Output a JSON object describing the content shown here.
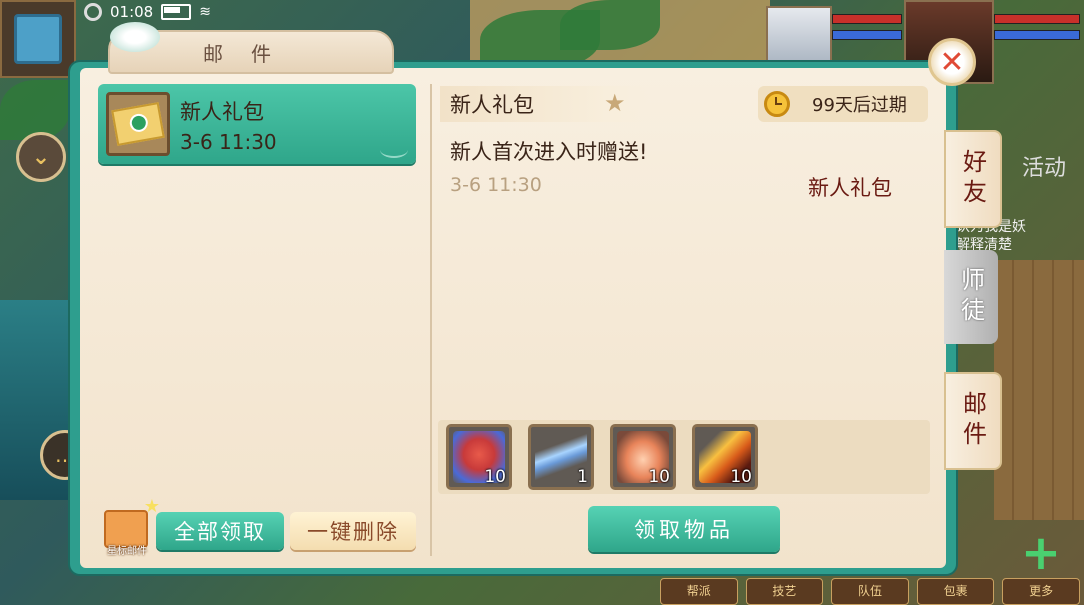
{
  "status_bar": {
    "time": "01:08"
  },
  "mail_panel": {
    "tab_title": "邮件",
    "close_icon": "close-icon",
    "mail_list": [
      {
        "title": "新人礼包",
        "date": "3-6 11:30",
        "icon": "envelope-icon"
      }
    ],
    "bottom_buttons": {
      "starred_label": "星标邮件",
      "claim_all": "全部领取",
      "delete_all": "一键删除"
    },
    "detail": {
      "title": "新人礼包",
      "expire": "99天后过期",
      "body": "新人首次进入时赠送!",
      "date": "3-6 11:30",
      "sender": "新人礼包",
      "attachments": [
        {
          "name": "gift-bag-item",
          "count": "10",
          "color": "#c83a3a"
        },
        {
          "name": "blue-wing-item",
          "count": "1",
          "color": "#6a9ad8"
        },
        {
          "name": "orange-scroll-item",
          "count": "10",
          "color": "#e8845a"
        },
        {
          "name": "fire-feather-item",
          "count": "10",
          "color": "#d85a1a"
        }
      ],
      "claim_button": "领取物品"
    }
  },
  "side_tabs": [
    {
      "label": "好友",
      "active": false,
      "highlight": true
    },
    {
      "label": "师徒",
      "active": false
    },
    {
      "label": "邮件",
      "active": true
    }
  ],
  "background": {
    "activity_label": "活动",
    "chat_lines": [
      "认为我是妖",
      "解释清楚"
    ],
    "bottom_menu": [
      "帮派",
      "技艺",
      "队伍",
      "包裹",
      "更多"
    ]
  },
  "colors": {
    "accent_green": "#2fa68a",
    "panel_cream": "#f8efe0",
    "text_brown": "#3a2418",
    "close_red": "#e04a36"
  }
}
